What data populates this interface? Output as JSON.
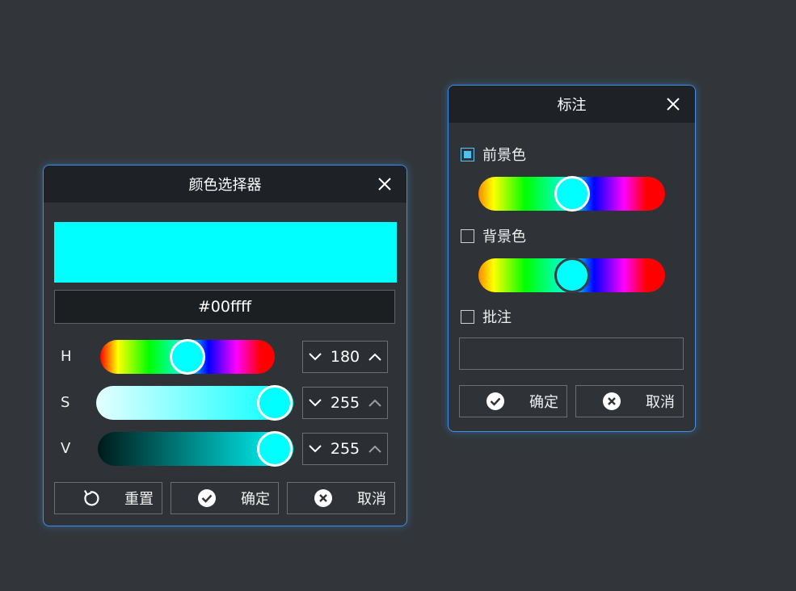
{
  "picker": {
    "title": "颜色选择器",
    "preview_color": "#00ffff",
    "hex": "#00ffff",
    "rows": {
      "h": {
        "label": "H",
        "value": "180"
      },
      "s": {
        "label": "S",
        "value": "255"
      },
      "v": {
        "label": "V",
        "value": "255"
      }
    },
    "buttons": {
      "reset": "重置",
      "ok": "确定",
      "cancel": "取消"
    }
  },
  "annotation": {
    "title": "标注",
    "foreground": {
      "label": "前景色",
      "checked": true,
      "hue_fraction": 0.5
    },
    "background": {
      "label": "背景色",
      "checked": false,
      "hue_fraction": 0.5
    },
    "note": {
      "label": "批注",
      "checked": false,
      "value": ""
    },
    "buttons": {
      "ok": "确定",
      "cancel": "取消"
    }
  },
  "colors": {
    "accent_border": "#3d8fe6",
    "thumb": "#00ffff",
    "checkbox_active": "#4fc0f0"
  },
  "icons": [
    "close-icon",
    "chevron-down-icon",
    "chevron-up-icon",
    "reset-icon",
    "check-circle-icon",
    "cancel-circle-icon"
  ]
}
